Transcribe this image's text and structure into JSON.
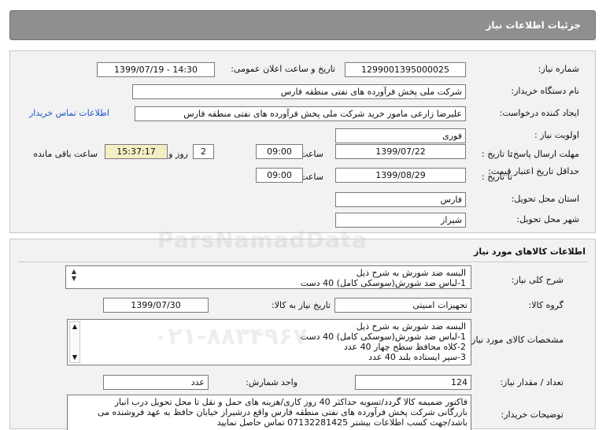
{
  "header": {
    "title": "جزئیات اطلاعات نیاز"
  },
  "need_info": {
    "need_number_label": "شماره نیاز:",
    "need_number": "1299001395000025",
    "announce_datetime_label": "تاریخ و ساعت اعلان عمومی:",
    "announce_datetime": "1399/07/19 - 14:30",
    "buyer_org_label": "نام دستگاه خریدار:",
    "buyer_org": "شرکت ملی پخش فرآورده های نفتی منطقه فارس",
    "requester_label": "ایجاد کننده درخواست:",
    "requester": "علیرضا زارعی مامور خرید شرکت ملی پخش فرآورده های نفتی منطقه فارس",
    "buyer_contact_link": "اطلاعات تماس خریدار",
    "priority_label": "اولویت نیاز :",
    "priority": "فوری",
    "reply_deadline_label": "مهلت ارسال پاسخ:",
    "until_date_label": "تا تاریخ :",
    "reply_date": "1399/07/22",
    "time_label": "ساعت",
    "reply_time": "09:00",
    "days_remaining": "2",
    "days_and_label": "روز و",
    "time_remaining": "15:37:17",
    "time_remaining_label": "ساعت باقی مانده",
    "price_validity_label": "حداقل تاریخ اعتبار قیمت:",
    "price_validity_until_label": "تا تاریخ :",
    "price_validity_date": "1399/08/29",
    "price_validity_time_label": "ساعت",
    "price_validity_time": "09:00",
    "delivery_province_label": "استان محل تحویل:",
    "delivery_province": "فارس",
    "delivery_city_label": "شهر محل تحویل:",
    "delivery_city": "شیراز"
  },
  "goods_info": {
    "section_title": "اطلاعات کالاهای مورد نیاز",
    "general_desc_label": "شرح کلی نیاز:",
    "general_desc_lines": [
      "البسه ضد شورش به شرح ذیل",
      "1-لباس ضد شورش(سوسکی کامل) 40 دست"
    ],
    "goods_group_label": "گروه کالا:",
    "goods_group": "تجهیزات امنیتی",
    "need_date_label": "تاریخ نیاز به کالا:",
    "need_date": "1399/07/30",
    "specs_label": "مشخصات کالای مورد نیاز:",
    "specs_lines": [
      "البسه ضد شورش به شرح ذیل",
      "1-لباس ضد شورش(سوسکی کامل) 40 دست",
      "2-کلاه محافظ سطح چهار 40 عدد",
      "3-سپر ایستاده بلند 40 عدد"
    ],
    "quantity_label": "تعداد / مقدار نیاز:",
    "quantity": "124",
    "unit_label": "واحد شمارش:",
    "unit": "عدد",
    "buyer_notes_label": "توضیحات خریدار:",
    "buyer_notes_lines": [
      "فاکتور ضمیمه کالا گردد/تسویه حداکثر 40 روز کاری/هزینه های حمل و نقل تا محل تحویل درب انبار",
      "بازرگانی شرکت پخش فرآورده های نفتی منطقه فارس واقع درشیراز خیابان حافظ به عهد فروشنده می",
      "باشد/جهت کسب اطلاعات بیشتر  07132281425 تماس حاصل نمایید"
    ]
  },
  "watermark": {
    "text": "ParsNamadData",
    "phone": "۰۲۱-۸۸۳۴۹۶۷۰"
  }
}
